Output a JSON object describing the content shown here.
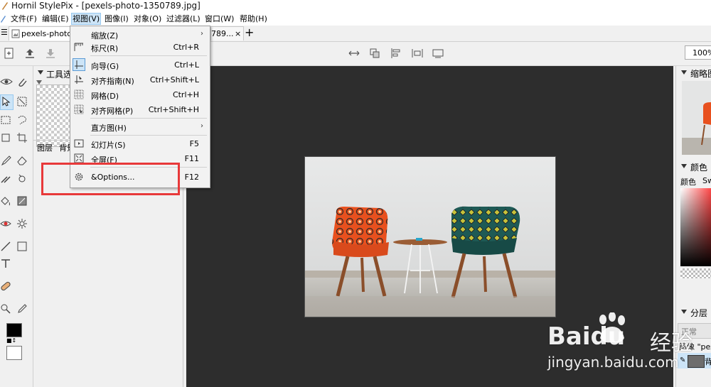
{
  "window": {
    "title": "Hornil StylePix - [pexels-photo-1350789.jpg]"
  },
  "menubar": [
    {
      "label": "文件(F)"
    },
    {
      "label": "编辑(E)"
    },
    {
      "label": "视图(V)",
      "active": true
    },
    {
      "label": "图像(I)"
    },
    {
      "label": "对象(O)"
    },
    {
      "label": "过滤器(L)"
    },
    {
      "label": "窗口(W)"
    },
    {
      "label": "帮助(H)"
    }
  ],
  "tabs": {
    "doc1": "pexels-photo",
    "doc2_tail": "789...",
    "close": "×",
    "add": "+"
  },
  "toolbar": {
    "zoom": "100%"
  },
  "toolpanel": {
    "title": "工具选项",
    "tab_layers": "图层",
    "tab_bg": "背景"
  },
  "view_menu": {
    "items": [
      {
        "label": "缩放(Z)",
        "shortcut": "",
        "submenu": true,
        "icon": ""
      },
      {
        "label": "标尺(R)",
        "shortcut": "Ctrl+R",
        "submenu": false,
        "icon": "ruler-icon"
      },
      {
        "label": "向导(G)",
        "shortcut": "Ctrl+L",
        "submenu": false,
        "icon": "guide-icon"
      },
      {
        "label": "对齐指南(N)",
        "shortcut": "Ctrl+Shift+L",
        "submenu": false,
        "icon": "snap-guide-icon"
      },
      {
        "label": "网格(D)",
        "shortcut": "Ctrl+H",
        "submenu": false,
        "icon": "grid-icon"
      },
      {
        "label": "对齐网格(P)",
        "shortcut": "Ctrl+Shift+H",
        "submenu": false,
        "icon": "snap-grid-icon"
      },
      {
        "label": "直方图(H)",
        "shortcut": "",
        "submenu": true,
        "icon": ""
      },
      {
        "label": "幻灯片(S)",
        "shortcut": "F5",
        "submenu": false,
        "icon": "slideshow-icon"
      },
      {
        "label": "全屏(F)",
        "shortcut": "F11",
        "submenu": false,
        "icon": "fullscreen-icon"
      },
      {
        "label": "&Options...",
        "shortcut": "F12",
        "submenu": false,
        "icon": "gear-icon"
      }
    ],
    "submenu_arrow": "›"
  },
  "right_panels": {
    "thumbnail": "缩略图",
    "color": "颜色",
    "color_tab1": "颜色",
    "color_tab2": "Sw",
    "layers": "分层",
    "blend_mode": "正常",
    "layer_name": "图像 \"pex",
    "layer_row": "背"
  },
  "watermark": {
    "brand": "Baidu",
    "cn": "经验",
    "url": "jingyan.baidu.com"
  },
  "colors": {
    "accent_red": "#e8393a",
    "menu_highlight": "#cce4f7",
    "canvas_bg": "#2d2d2d"
  }
}
